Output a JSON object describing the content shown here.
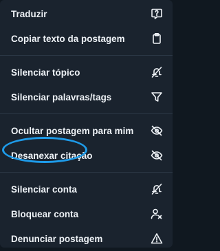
{
  "menu": {
    "groups": [
      [
        {
          "label": "Traduzir",
          "icon": "translate-icon"
        },
        {
          "label": "Copiar texto da postagem",
          "icon": "clipboard-icon"
        }
      ],
      [
        {
          "label": "Silenciar tópico",
          "icon": "mute-bell-icon"
        },
        {
          "label": "Silenciar palavras/tags",
          "icon": "filter-icon"
        }
      ],
      [
        {
          "label": "Ocultar postagem para mim",
          "icon": "eye-slash-icon"
        },
        {
          "label": "Desanexar citação",
          "icon": "eye-slash-icon"
        }
      ],
      [
        {
          "label": "Silenciar conta",
          "icon": "mute-bell-icon"
        },
        {
          "label": "Bloquear conta",
          "icon": "block-person-icon"
        },
        {
          "label": "Denunciar postagem",
          "icon": "warning-icon"
        }
      ]
    ]
  },
  "annotation": {
    "highlight_color": "#1e9be9",
    "highlighted_item": "Desanexar citação"
  },
  "colors": {
    "background": "#1a232e",
    "text": "#eef2f6",
    "divider": "#2c3846"
  }
}
